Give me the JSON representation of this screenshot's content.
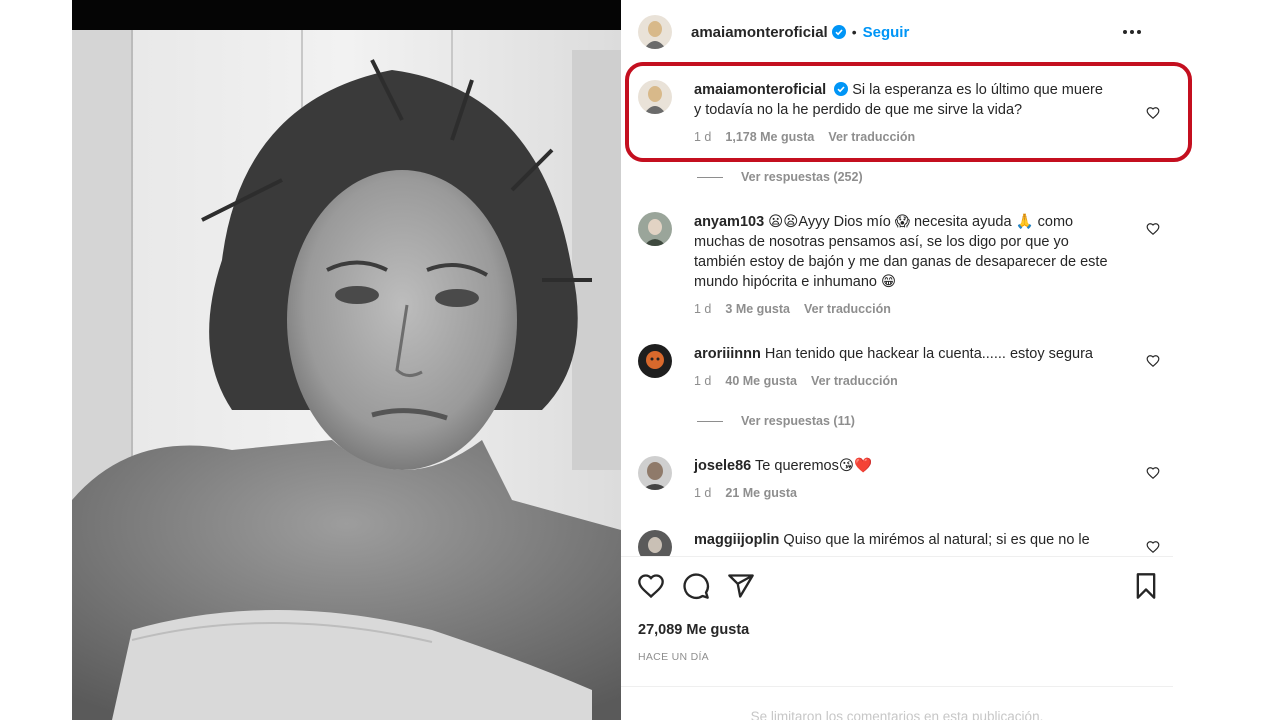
{
  "post": {
    "author": "amaiamonteroficial",
    "follow_label": "Seguir",
    "separator": "•"
  },
  "caption": {
    "username": "amaiamonteroficial",
    "text": "Si la esperanza es lo último que muere y todavía no la he perdido de que me sirve la vida?",
    "time": "1 d",
    "likes": "1,178 Me gusta",
    "translate": "Ver traducción",
    "replies": "Ver respuestas (252)"
  },
  "comments": [
    {
      "username": "anyam103",
      "text": "😦😦Ayyy Dios mío 😱 necesita ayuda 🙏 como muchas de nosotras pensamos así, se los digo por que yo también estoy de bajón y me dan ganas de desaparecer de este mundo hipócrita e inhumano 😁",
      "time": "1 d",
      "likes": "3 Me gusta",
      "translate": "Ver traducción"
    },
    {
      "username": "aroriiinnn",
      "text": "Han tenido que hackear la cuenta...... estoy segura",
      "time": "1 d",
      "likes": "40 Me gusta",
      "translate": "Ver traducción",
      "replies": "Ver respuestas (11)"
    },
    {
      "username": "josele86",
      "text": "Te queremos😘❤️",
      "time": "1 d",
      "likes": "21 Me gusta"
    },
    {
      "username": "maggiijoplin",
      "text": "Quiso que la mirémos al natural; si es que no le"
    }
  ],
  "footer": {
    "total_likes": "27,089 Me gusta",
    "posted": "HACE UN DÍA",
    "limited_notice": "Se limitaron los comentarios en esta publicación."
  },
  "icons": {
    "verified": "verified-badge-icon",
    "more": "more-options-icon",
    "like": "heart-icon",
    "comment": "comment-icon",
    "share": "share-icon",
    "save": "bookmark-icon"
  },
  "colors": {
    "link": "#0095f6",
    "highlight": "#c40f1f",
    "muted": "#8e8e8e"
  }
}
